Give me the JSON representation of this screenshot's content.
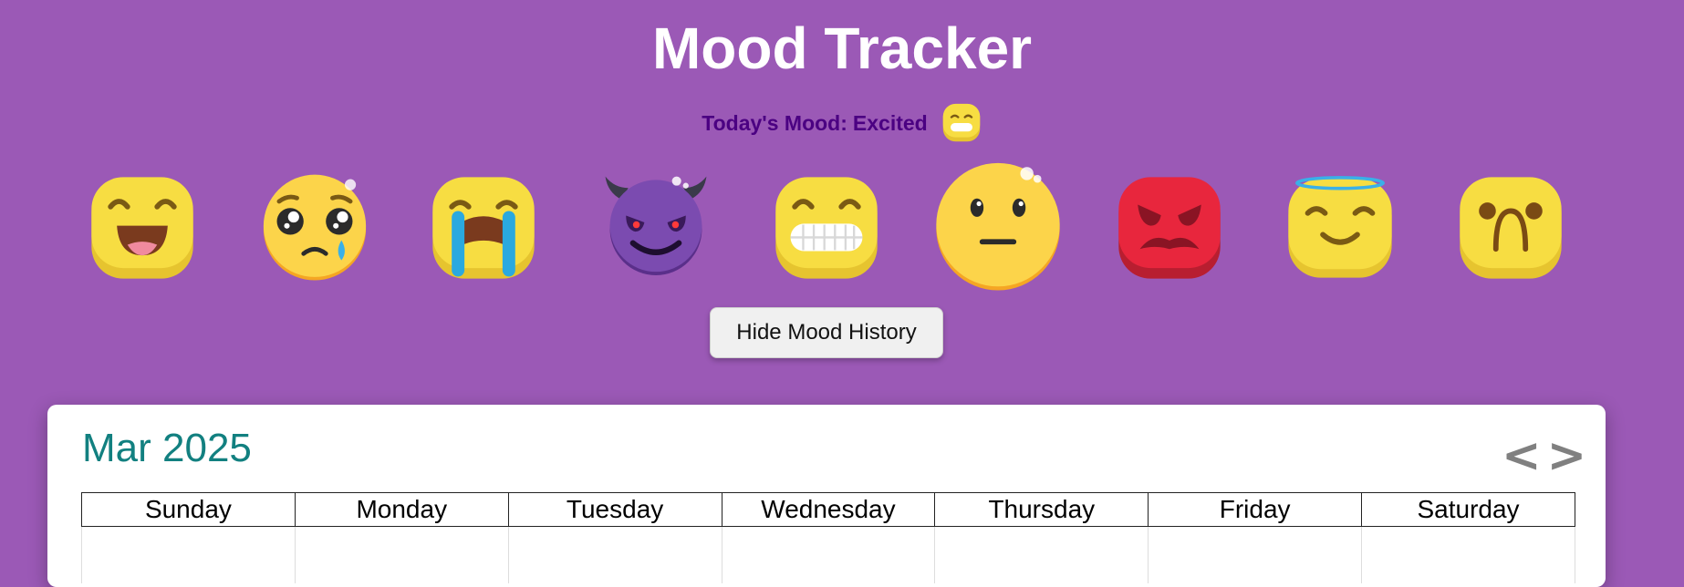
{
  "header": {
    "title": "Mood Tracker"
  },
  "today": {
    "label": "Today's Mood:",
    "mood": "Excited",
    "icon": "grimace-emoji-icon"
  },
  "moods": [
    {
      "icon": "laughing-emoji-icon"
    },
    {
      "icon": "pleading-teary-emoji-icon"
    },
    {
      "icon": "crying-emoji-icon"
    },
    {
      "icon": "devil-emoji-icon"
    },
    {
      "icon": "grimace-emoji-icon"
    },
    {
      "icon": "neutral-emoji-icon"
    },
    {
      "icon": "angry-red-emoji-icon"
    },
    {
      "icon": "angel-halo-emoji-icon"
    },
    {
      "icon": "frowning-emoji-icon"
    }
  ],
  "toggle_history_label": "Hide Mood History",
  "calendar": {
    "month_label": "Mar 2025",
    "prev_label": "<",
    "next_label": ">",
    "weekdays": [
      "Sunday",
      "Monday",
      "Tuesday",
      "Wednesday",
      "Thursday",
      "Friday",
      "Saturday"
    ]
  },
  "colors": {
    "background": "#9b59b6",
    "today_label": "#4b0082",
    "month_label": "#128080",
    "emoji_yellow": "#f7dd42",
    "angry_red": "#e8263d",
    "devil_purple": "#7b4bb0"
  }
}
